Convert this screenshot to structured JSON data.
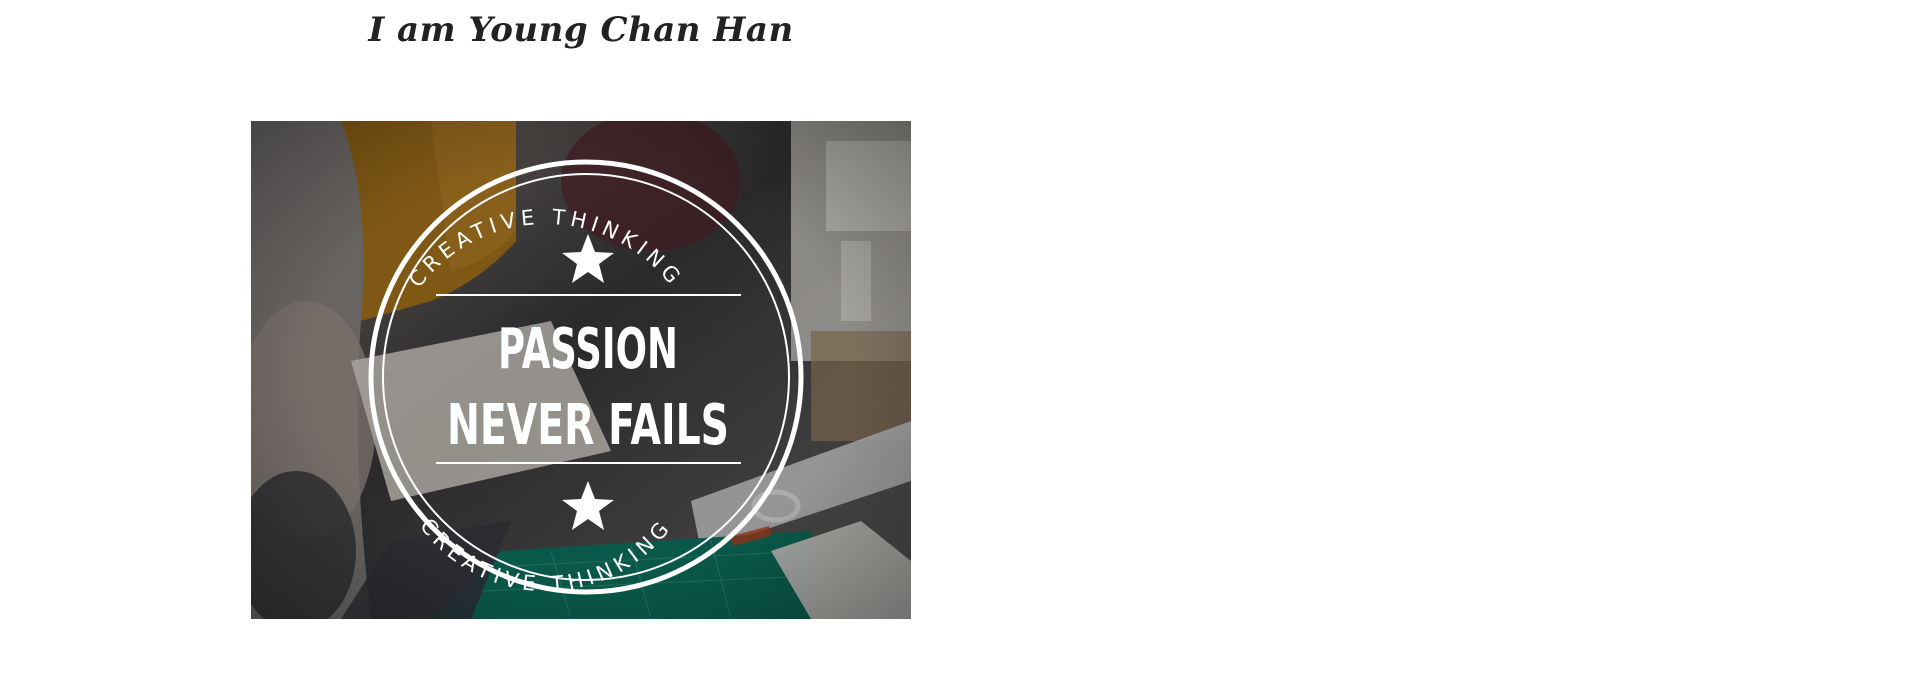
{
  "page": {
    "title": "I am Young Chan Han"
  },
  "hero": {
    "badge": {
      "arc_top": "CREATIVE THINKING",
      "arc_bottom": "CREATIVE THINKING",
      "line1": "PASSION",
      "line2": "NEVER FAILS",
      "star_icon": "star-icon"
    },
    "colors": {
      "badge": "#ffffff",
      "cutting_mat": "#0f7a66",
      "sweater": "#b07a1e"
    }
  }
}
